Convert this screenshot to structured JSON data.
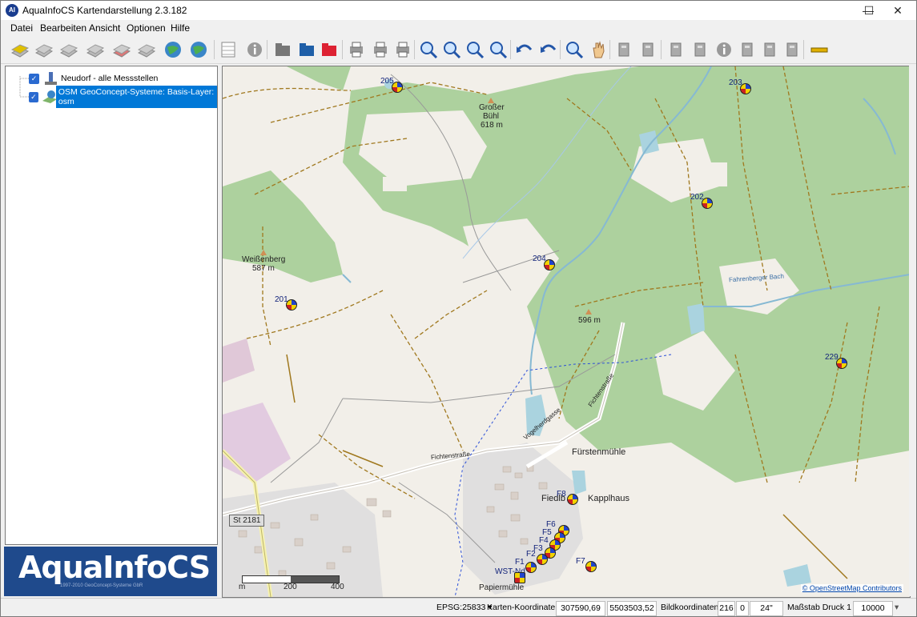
{
  "window": {
    "title": "AquaInfoCS Kartendarstellung 2.3.182",
    "icon_label": "AI",
    "controls": {
      "minimize": "—",
      "maximize": "☐",
      "close": "✕"
    }
  },
  "menu": [
    "Datei",
    "Bearbeiten",
    "Ansicht",
    "Optionen",
    "Hilfe"
  ],
  "toolbar_icons": [
    "layer-manager-icon",
    "layer-icon-1",
    "layer-icon-2",
    "layer-icon-3",
    "layer-colored-icon",
    "layer-terrain-icon",
    "globe-layer-icon",
    "globe-icon",
    "table-icon",
    "info-icon",
    "folder-open-icon",
    "save-icon",
    "export-icon",
    "print-preview-icon",
    "print-icon",
    "print-setup-icon",
    "zoom-extent-icon",
    "zoom-window-icon",
    "zoom-in-icon",
    "zoom-out-icon",
    "undo-view-icon",
    "redo-view-icon",
    "zoom-select-icon",
    "pan-hand-icon",
    "select-arrow-icon",
    "crosshair-icon",
    "column-icon",
    "sign-icon",
    "marker-info-icon",
    "tool-icon",
    "flask-icon",
    "ruler-vertical-icon",
    "measure-icon"
  ],
  "tree": [
    {
      "label": "Neudorf - alle Messstellen",
      "checked": true,
      "selected": false
    },
    {
      "label": "OSM GeoConcept-Systeme: Basis-Layer: osm",
      "checked": true,
      "selected": true
    }
  ],
  "logo": {
    "text": "AquaInfoCS",
    "copyright": "1997-2010 GeoConcept-Systeme GbR"
  },
  "map": {
    "places": [
      {
        "text": "Großer",
        "key": "grosser"
      },
      {
        "text": "Bühl",
        "key": "buehl"
      },
      {
        "text": "618 m",
        "key": "h618"
      },
      {
        "text": "Weißenberg",
        "key": "weissenberg"
      },
      {
        "text": "587 m",
        "key": "h587"
      },
      {
        "text": "596 m",
        "key": "h596"
      },
      {
        "text": "Fürstenmühle",
        "key": "fuerstenmuehle"
      },
      {
        "text": "Kapplhaus",
        "key": "kapplhaus"
      },
      {
        "text": "Fiedlb",
        "key": "fiedlb"
      },
      {
        "text": "Papiermühle",
        "key": "papiermuehle"
      },
      {
        "text": "Fichtenstraße",
        "key": "fichtenstrasse"
      },
      {
        "text": "Fichtenstraße",
        "key": "fichtenstrasse2"
      },
      {
        "text": "Vogelherdgasse",
        "key": "vogelherdgasse"
      },
      {
        "text": "St 2181",
        "key": "st2181"
      },
      {
        "text": "Fahrenberger Bach",
        "key": "fahrenberger"
      }
    ],
    "markers": [
      {
        "label": "205"
      },
      {
        "label": "203"
      },
      {
        "label": "202"
      },
      {
        "label": "204"
      },
      {
        "label": "201"
      },
      {
        "label": "229"
      },
      {
        "label": "F8"
      },
      {
        "label": "F6"
      },
      {
        "label": "F5"
      },
      {
        "label": "F4"
      },
      {
        "label": "F3"
      },
      {
        "label": "F2"
      },
      {
        "label": "F1"
      },
      {
        "label": "F7"
      },
      {
        "label": "WST-Nd"
      }
    ],
    "scale": {
      "unit": "m",
      "mid": "200",
      "end": "400"
    },
    "attribution": "© OpenStreetMap Contributors",
    "colors": {
      "forest": "#add19e",
      "land": "#f2efe9",
      "water": "#aad3df",
      "track": "#a0781e"
    }
  },
  "status": {
    "crs": "EPSG:25833",
    "dropdown_arrow": "▾",
    "map_coords_label": "Karten-Koordinaten",
    "x": "307590,69",
    "y": "5503503,52",
    "image_coords_label": "Bildkoordinaten",
    "px": "216",
    "py": "0",
    "angle": "24\"",
    "scale_label": "Maßstab Druck 1 :",
    "scale_value": "10000"
  }
}
